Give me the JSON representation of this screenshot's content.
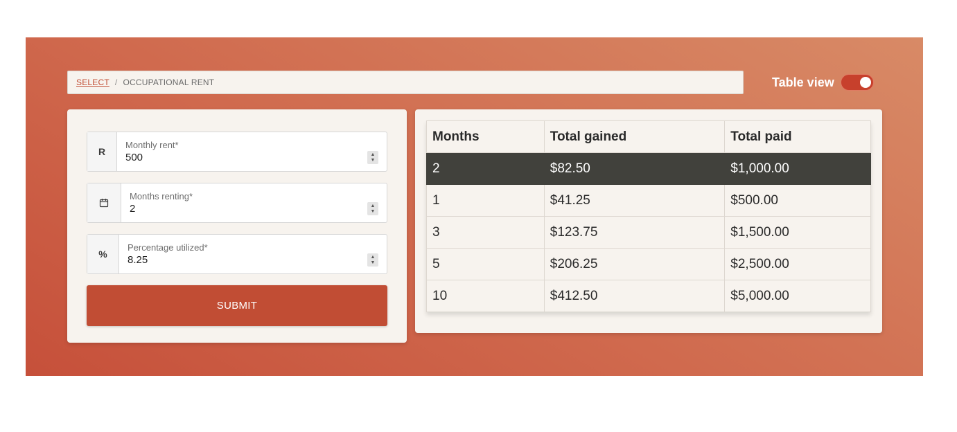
{
  "breadcrumb": {
    "link": "SELECT",
    "separator": "/",
    "current": "OCCUPATIONAL RENT"
  },
  "view_toggle": {
    "label": "Table view",
    "on": true
  },
  "form": {
    "fields": [
      {
        "addon": "R",
        "label": "Monthly rent*",
        "value": "500"
      },
      {
        "addon_icon": "calendar-icon",
        "label": "Months renting*",
        "value": "2"
      },
      {
        "addon": "%",
        "label": "Percentage utilized*",
        "value": "8.25"
      }
    ],
    "submit_label": "SUBMIT"
  },
  "table": {
    "headers": [
      "Months",
      "Total gained",
      "Total paid"
    ],
    "rows": [
      [
        "2",
        "$82.50",
        "$1,000.00"
      ],
      [
        "1",
        "$41.25",
        "$500.00"
      ],
      [
        "3",
        "$123.75",
        "$1,500.00"
      ],
      [
        "5",
        "$206.25",
        "$2,500.00"
      ],
      [
        "10",
        "$412.50",
        "$5,000.00"
      ]
    ],
    "highlighted_row": 0
  },
  "colors": {
    "accent": "#c14d34",
    "highlight_row": "#41413c",
    "card_background": "#f7f3ee"
  }
}
